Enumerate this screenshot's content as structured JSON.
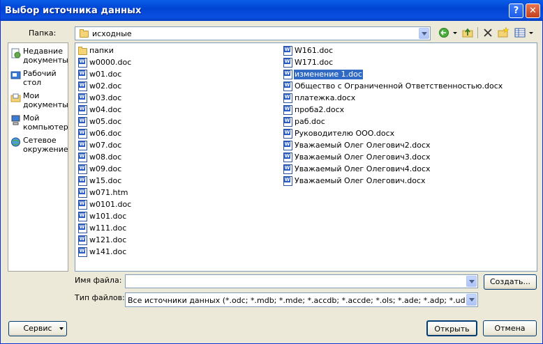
{
  "window": {
    "title": "Выбор источника данных",
    "help_glyph": "?",
    "close_glyph": "✕"
  },
  "lookin": {
    "label": "Папка:",
    "value": "исходные"
  },
  "places": [
    {
      "label": "Недавние документы",
      "icon": "recent-documents-icon"
    },
    {
      "label": "Рабочий стол",
      "icon": "desktop-icon"
    },
    {
      "label": "Мои документы",
      "icon": "my-documents-icon"
    },
    {
      "label": "Мой компьютер",
      "icon": "my-computer-icon"
    },
    {
      "label": "Сетевое окружение",
      "icon": "network-places-icon"
    }
  ],
  "files_col1": [
    {
      "name": "папки",
      "type": "folder"
    },
    {
      "name": "w0000.doc",
      "type": "doc"
    },
    {
      "name": "w01.doc",
      "type": "doc"
    },
    {
      "name": "w02.doc",
      "type": "doc"
    },
    {
      "name": "w03.doc",
      "type": "doc"
    },
    {
      "name": "w04.doc",
      "type": "doc"
    },
    {
      "name": "w05.doc",
      "type": "doc"
    },
    {
      "name": "w06.doc",
      "type": "doc"
    },
    {
      "name": "w07.doc",
      "type": "doc"
    },
    {
      "name": "w08.doc",
      "type": "doc"
    },
    {
      "name": "w09.doc",
      "type": "doc"
    },
    {
      "name": "w15.doc",
      "type": "doc"
    },
    {
      "name": "w071.htm",
      "type": "htm"
    },
    {
      "name": "w0101.doc",
      "type": "doc"
    },
    {
      "name": "w101.doc",
      "type": "doc"
    },
    {
      "name": "w111.doc",
      "type": "doc"
    },
    {
      "name": "w121.doc",
      "type": "doc"
    },
    {
      "name": "w141.doc",
      "type": "doc"
    }
  ],
  "files_col2": [
    {
      "name": "W161.doc",
      "type": "doc"
    },
    {
      "name": "W171.doc",
      "type": "doc"
    },
    {
      "name": "изменение 1.doc",
      "type": "doc",
      "selected": true
    },
    {
      "name": "Общество с Ограниченной Ответственностью.docx",
      "type": "docx"
    },
    {
      "name": "платежка.docx",
      "type": "docx"
    },
    {
      "name": "проба2.docx",
      "type": "docx"
    },
    {
      "name": "раб.doc",
      "type": "doc"
    },
    {
      "name": "Руководителю ООО.docx",
      "type": "docx"
    },
    {
      "name": "Уважаемый Олег Олегович2.docx",
      "type": "docx"
    },
    {
      "name": "Уважаемый Олег Олегович3.docx",
      "type": "docx"
    },
    {
      "name": "Уважаемый Олег Олегович4.docx",
      "type": "docx"
    },
    {
      "name": "Уважаемый Олег Олегович.docx",
      "type": "docx"
    }
  ],
  "filename": {
    "label": "Имя файла:",
    "value": ""
  },
  "filetype": {
    "label": "Тип файлов:",
    "value": "Все источники данных (*.odc; *.mdb; *.mde; *.accdb; *.accde; *.ols; *.ade; *.adp; *.udl; *.dsn;"
  },
  "buttons": {
    "create": "Создать...",
    "service": "Сервис",
    "open": "Открыть",
    "cancel": "Отмена"
  },
  "colors": {
    "titlebar": "#0a5ee8",
    "selection": "#316ac5",
    "border_accent": "#003c74"
  }
}
